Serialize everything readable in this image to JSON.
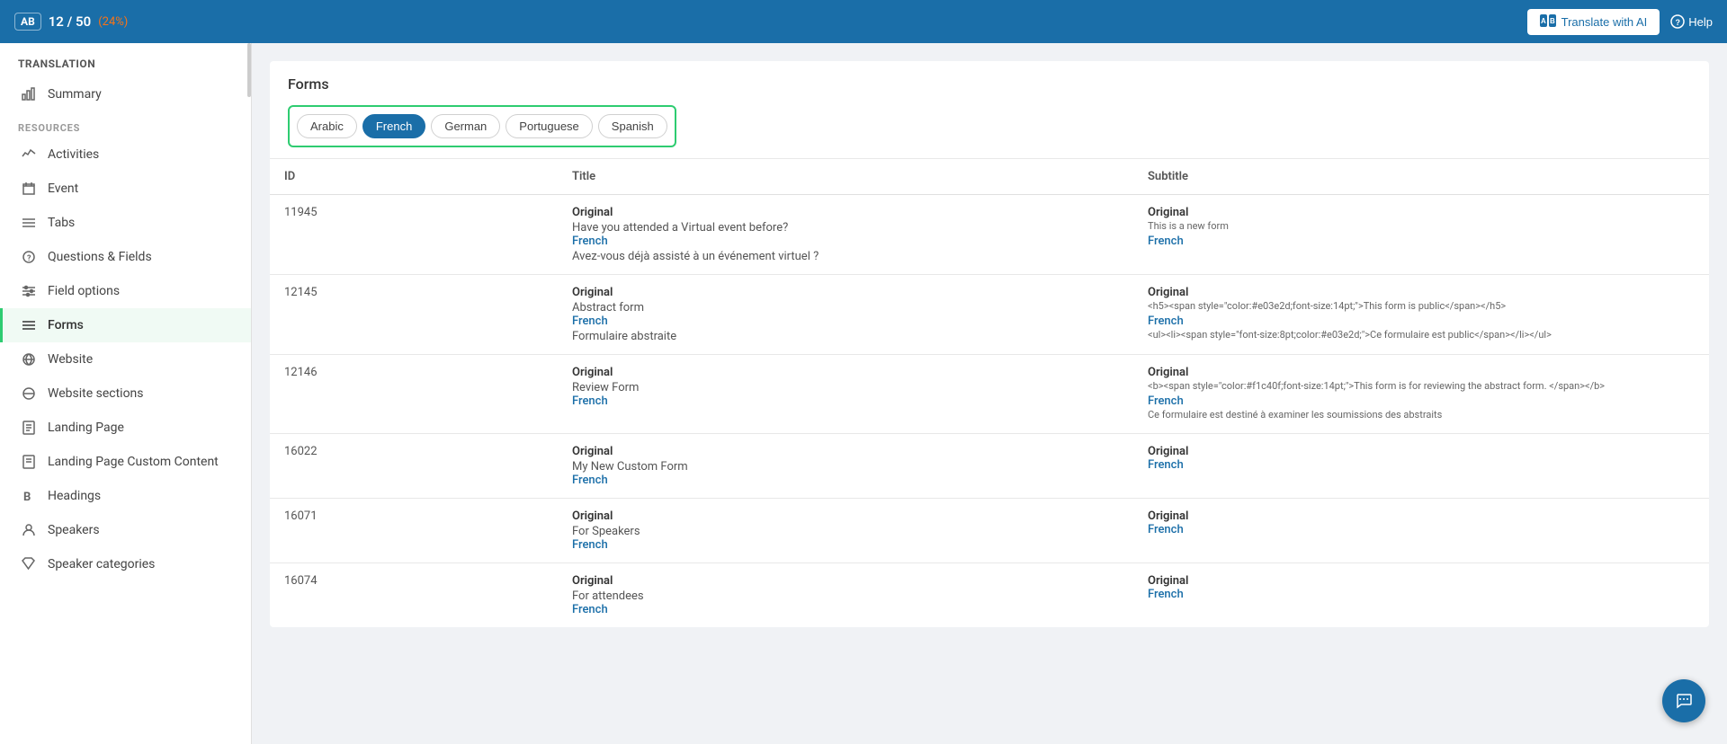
{
  "topbar": {
    "badge_label": "AB",
    "count_current": "12",
    "count_total": "50",
    "count_percent": "(24%)",
    "translate_ai_label": "Translate with AI",
    "help_label": "Help"
  },
  "sidebar": {
    "title": "TRANSLATION",
    "summary_label": "Summary",
    "resources_label": "RESOURCES",
    "items": [
      {
        "id": "activities",
        "label": "Activities",
        "icon": "bar-chart"
      },
      {
        "id": "event",
        "label": "Event",
        "icon": "home"
      },
      {
        "id": "tabs",
        "label": "Tabs",
        "icon": "list"
      },
      {
        "id": "questions-fields",
        "label": "Questions & Fields",
        "icon": "question"
      },
      {
        "id": "field-options",
        "label": "Field options",
        "icon": "sliders"
      },
      {
        "id": "forms",
        "label": "Forms",
        "icon": "list-check",
        "active": true
      },
      {
        "id": "website",
        "label": "Website",
        "icon": "link"
      },
      {
        "id": "website-sections",
        "label": "Website sections",
        "icon": "link"
      },
      {
        "id": "landing-page",
        "label": "Landing Page",
        "icon": "file"
      },
      {
        "id": "landing-page-custom",
        "label": "Landing Page Custom Content",
        "icon": "file"
      },
      {
        "id": "headings",
        "label": "Headings",
        "icon": "bold-b"
      },
      {
        "id": "speakers",
        "label": "Speakers",
        "icon": "graduation"
      },
      {
        "id": "speaker-categories",
        "label": "Speaker categories",
        "icon": "tag"
      }
    ]
  },
  "forms": {
    "title": "Forms",
    "languages": [
      {
        "id": "arabic",
        "label": "Arabic",
        "active": false
      },
      {
        "id": "french",
        "label": "French",
        "active": true
      },
      {
        "id": "german",
        "label": "German",
        "active": false
      },
      {
        "id": "portuguese",
        "label": "Portuguese",
        "active": false
      },
      {
        "id": "spanish",
        "label": "Spanish",
        "active": false
      }
    ],
    "columns": {
      "id": "ID",
      "title": "Title",
      "subtitle": "Subtitle"
    },
    "rows": [
      {
        "id": "11945",
        "title_original_label": "Original",
        "title_original_text": "Have you attended a Virtual event before?",
        "title_french_label": "French",
        "title_french_text": "Avez-vous déjà assisté à un événement virtuel ?",
        "subtitle_original_label": "Original",
        "subtitle_original_text": "This is a new form",
        "subtitle_french_label": "French",
        "subtitle_french_text": ""
      },
      {
        "id": "12145",
        "title_original_label": "Original",
        "title_original_text": "Abstract form",
        "title_french_label": "French",
        "title_french_text": "Formulaire abstraite",
        "subtitle_original_label": "Original",
        "subtitle_original_text": "<h5><span style=\"color:#e03e2d;font-size:14pt;\">This form is public</span></h5>",
        "subtitle_french_label": "French",
        "subtitle_french_text": "<ul><li><span style=\"font-size:8pt;color:#e03e2d;\">Ce formulaire est public</span></li></ul>"
      },
      {
        "id": "12146",
        "title_original_label": "Original",
        "title_original_text": "Review Form",
        "title_french_label": "French",
        "title_french_text": "",
        "subtitle_original_label": "Original",
        "subtitle_original_text": "<b><span style=\"color:#f1c40f;font-size:14pt;\">This form is for reviewing the abstract form. </span></b>",
        "subtitle_french_label": "French",
        "subtitle_french_text": "Ce formulaire est destiné à examiner les soumissions des abstraits"
      },
      {
        "id": "16022",
        "title_original_label": "Original",
        "title_original_text": "My New Custom Form",
        "title_french_label": "French",
        "title_french_text": "",
        "subtitle_original_label": "Original",
        "subtitle_original_text": "",
        "subtitle_french_label": "French",
        "subtitle_french_text": ""
      },
      {
        "id": "16071",
        "title_original_label": "Original",
        "title_original_text": "For Speakers",
        "title_french_label": "French",
        "title_french_text": "",
        "subtitle_original_label": "Original",
        "subtitle_original_text": "",
        "subtitle_french_label": "French",
        "subtitle_french_text": ""
      },
      {
        "id": "16074",
        "title_original_label": "Original",
        "title_original_text": "For attendees",
        "title_french_label": "French",
        "title_french_text": "",
        "subtitle_original_label": "Original",
        "subtitle_original_text": "",
        "subtitle_french_label": "French",
        "subtitle_french_text": ""
      }
    ]
  }
}
